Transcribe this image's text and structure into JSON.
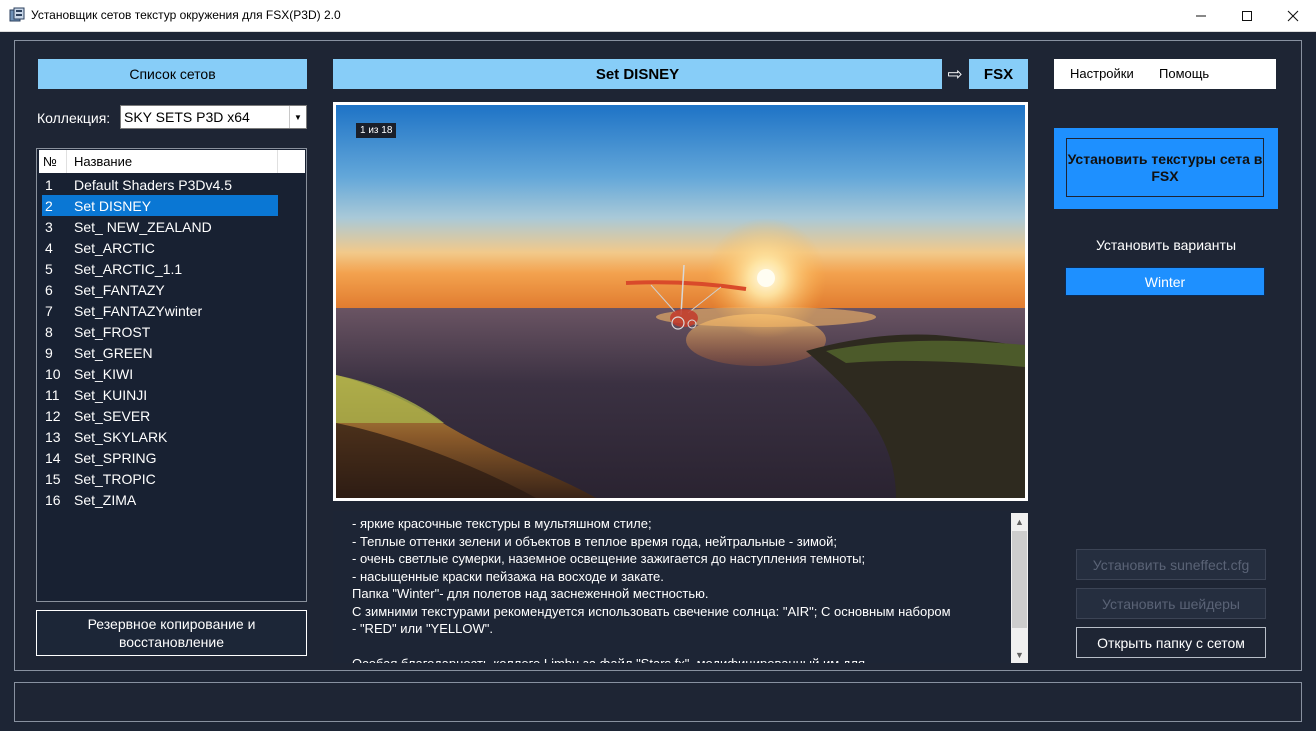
{
  "window": {
    "title": "Установщик сетов текстур окружения для FSX(P3D) 2.0"
  },
  "left": {
    "sets_header": "Список сетов",
    "collection_label": "Коллекция:",
    "collection_value": "SKY SETS P3D x64",
    "columns": {
      "num": "№",
      "name": "Название"
    },
    "sets": [
      {
        "n": "1",
        "name": "Default Shaders P3Dv4.5"
      },
      {
        "n": "2",
        "name": "Set DISNEY"
      },
      {
        "n": "3",
        "name": "Set_ NEW_ZEALAND"
      },
      {
        "n": "4",
        "name": "Set_ARCTIC"
      },
      {
        "n": "5",
        "name": "Set_ARCTIC_1.1"
      },
      {
        "n": "6",
        "name": "Set_FANTAZY"
      },
      {
        "n": "7",
        "name": "Set_FANTAZYwinter"
      },
      {
        "n": "8",
        "name": "Set_FROST"
      },
      {
        "n": "9",
        "name": "Set_GREEN"
      },
      {
        "n": "10",
        "name": "Set_KIWI"
      },
      {
        "n": "11",
        "name": "Set_KUINJI"
      },
      {
        "n": "12",
        "name": "Set_SEVER"
      },
      {
        "n": "13",
        "name": "Set_SKYLARK"
      },
      {
        "n": "14",
        "name": "Set_SPRING"
      },
      {
        "n": "15",
        "name": "Set_TROPIC"
      },
      {
        "n": "16",
        "name": "Set_ZIMA"
      }
    ],
    "selected_index": 1,
    "backup_button": "Резервное копирование и восстановление"
  },
  "center": {
    "set_title": "Set DISNEY",
    "arrow": "⇨",
    "target": "FSX",
    "counter": "1 из 18",
    "description": [
      "- яркие красочные текстуры в мультяшном стиле;",
      "- Теплые оттенки зелени и объектов в теплое время года, нейтральные - зимой;",
      "- очень светлые сумерки, наземное освещение зажигается до наступления темноты;",
      "- насыщенные краски пейзажа на восходе и закате.",
      "Папка \"Winter\"- для полетов над заснеженной местностью.",
      "С зимними текстурами рекомендуется использовать свечение солнца: \"AIR\"; С основным набором",
      "- \"RED\" или \"YELLOW\".",
      "",
      "Особая благодарность коллеге Limbu за файл \"Stars.fx\", модифицированный им для"
    ]
  },
  "menu": {
    "settings": "Настройки",
    "help": "Помощь"
  },
  "right": {
    "install_textures": "Установить текстуры сета в FSX",
    "variants_label": "Установить варианты",
    "variants": [
      "Winter"
    ],
    "suneffect_button": "Установить suneffect.cfg",
    "shaders_button": "Установить шейдеры",
    "open_folder_button": "Открыть папку с сетом"
  },
  "colors": {
    "background": "#1d2535",
    "accent_light": "#87cdf8",
    "accent": "#1e90ff",
    "selection": "#0a77d4"
  },
  "icons": {
    "app": "app-icon",
    "minimize": "minimize-icon",
    "maximize": "maximize-icon",
    "close": "close-icon",
    "dropdown": "chevron-down-icon",
    "scroll_up": "scroll-up-icon",
    "scroll_down": "scroll-down-icon",
    "arrow": "arrow-right-icon"
  }
}
